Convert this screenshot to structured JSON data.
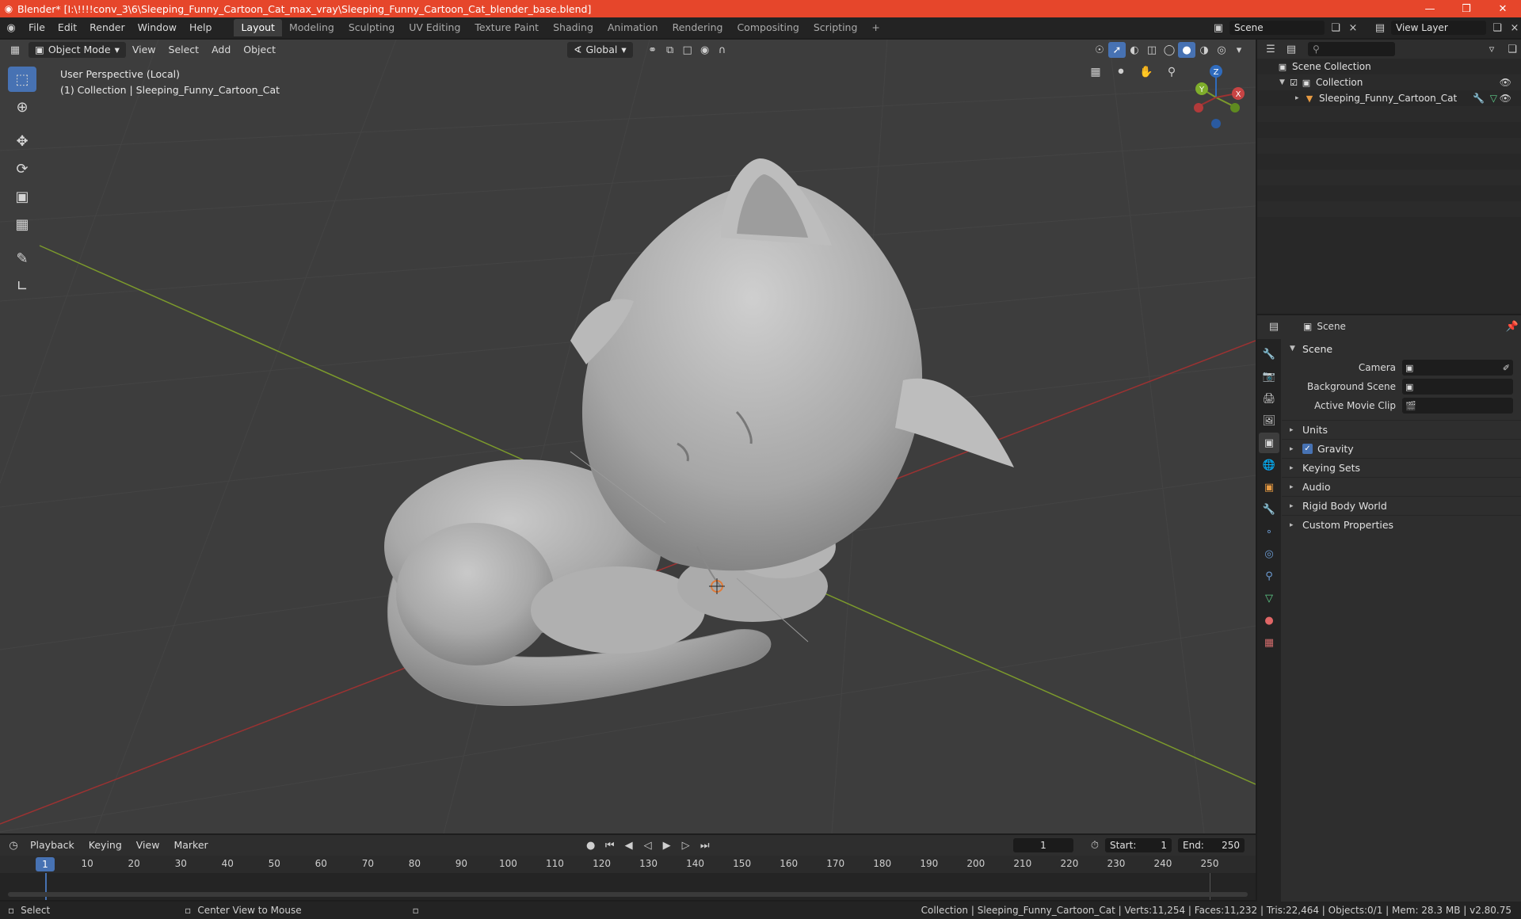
{
  "window": {
    "title": "Blender* [I:\\!!!!conv_3\\6\\Sleeping_Funny_Cartoon_Cat_max_vray\\Sleeping_Funny_Cartoon_Cat_blender_base.blend]",
    "minimize": "—",
    "maximize": "❒",
    "close": "✕"
  },
  "menu": [
    "File",
    "Edit",
    "Render",
    "Window",
    "Help"
  ],
  "workspaces": [
    {
      "label": "Layout",
      "active": true
    },
    {
      "label": "Modeling"
    },
    {
      "label": "Sculpting"
    },
    {
      "label": "UV Editing"
    },
    {
      "label": "Texture Paint"
    },
    {
      "label": "Shading"
    },
    {
      "label": "Animation"
    },
    {
      "label": "Rendering"
    },
    {
      "label": "Compositing"
    },
    {
      "label": "Scripting"
    }
  ],
  "scene_selector": {
    "value": "Scene"
  },
  "view_layer": {
    "value": "View Layer"
  },
  "viewport": {
    "mode": "Object Mode",
    "menus": [
      "View",
      "Select",
      "Add",
      "Object"
    ],
    "orientation": "Global",
    "overlay_line1": "User Perspective (Local)",
    "overlay_line2": "(1) Collection | Sleeping_Funny_Cartoon_Cat",
    "gizmo": {
      "x": "X",
      "y": "Y",
      "z": "Z"
    }
  },
  "outliner": {
    "search_placeholder": "",
    "rows": [
      {
        "label": "Scene Collection"
      },
      {
        "label": "Collection"
      },
      {
        "label": "Sleeping_Funny_Cartoon_Cat"
      }
    ]
  },
  "properties": {
    "header": "Scene",
    "panel": "Scene",
    "fields": [
      {
        "label": "Camera"
      },
      {
        "label": "Background Scene"
      },
      {
        "label": "Active Movie Clip"
      }
    ],
    "subpanels": [
      {
        "label": "Units",
        "checkbox": false
      },
      {
        "label": "Gravity",
        "checkbox": true
      },
      {
        "label": "Keying Sets",
        "checkbox": false
      },
      {
        "label": "Audio",
        "checkbox": false
      },
      {
        "label": "Rigid Body World",
        "checkbox": false
      },
      {
        "label": "Custom Properties",
        "checkbox": false
      }
    ]
  },
  "timeline": {
    "menus": [
      "Playback",
      "Keying",
      "View",
      "Marker"
    ],
    "current_frame": "1",
    "start_label": "Start:",
    "start": "1",
    "end_label": "End:",
    "end": "250",
    "ticks": [
      "1",
      "10",
      "20",
      "30",
      "40",
      "50",
      "60",
      "70",
      "80",
      "90",
      "100",
      "110",
      "120",
      "130",
      "140",
      "150",
      "160",
      "170",
      "180",
      "190",
      "200",
      "210",
      "220",
      "230",
      "240",
      "250"
    ]
  },
  "statusbar": {
    "left1": "Select",
    "left2": "Center View to Mouse",
    "right": "Collection | Sleeping_Funny_Cartoon_Cat | Verts:11,254 | Faces:11,232 | Tris:22,464 | Objects:0/1 | Mem: 28.3 MB | v2.80.75"
  },
  "colors": {
    "accent": "#4772b3",
    "titlebar": "#e6462b",
    "x_axis": "#9c3232",
    "y_axis": "#7c9a2c",
    "z_axis": "#2f6bbd"
  }
}
